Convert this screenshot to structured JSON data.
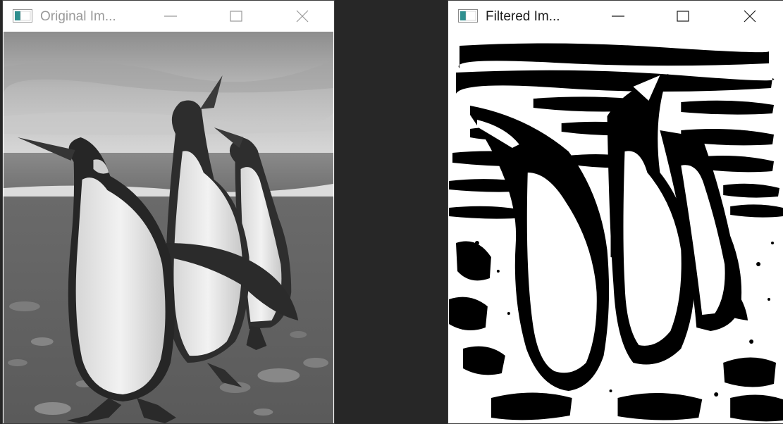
{
  "windows": {
    "original": {
      "title": "Original Im...",
      "icon": "opencv-window-icon",
      "controls": [
        "minimize-icon",
        "maximize-icon",
        "close-icon"
      ],
      "content": "grayscale penguins photo"
    },
    "filtered": {
      "title": "Filtered Im...",
      "icon": "opencv-window-icon",
      "controls": [
        "minimize-icon",
        "maximize-icon",
        "close-icon"
      ],
      "content": "thresholded black and white penguins image"
    }
  },
  "colors": {
    "desktop": "#272727",
    "titlebar": "#ffffff",
    "inactive_title": "#9a9a9a",
    "active_title": "#1b1b1b"
  }
}
